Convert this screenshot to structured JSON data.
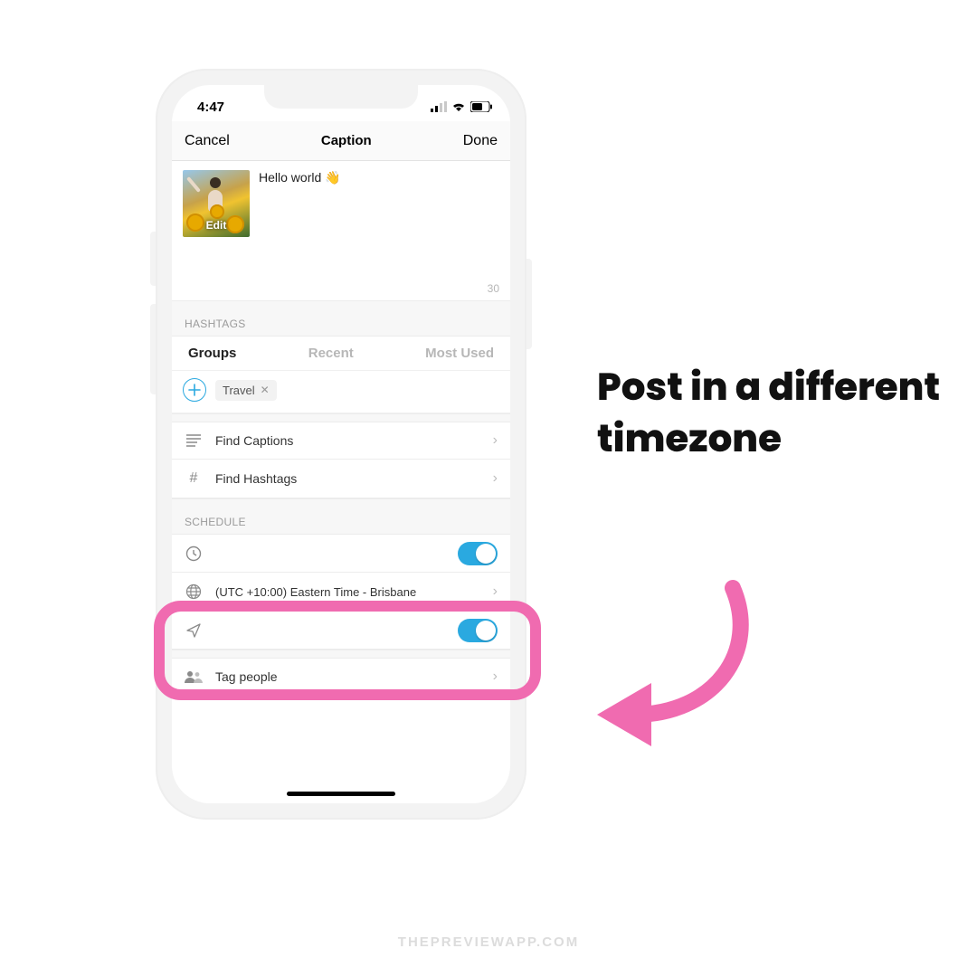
{
  "statusbar": {
    "time": "4:47"
  },
  "nav": {
    "cancel": "Cancel",
    "title": "Caption",
    "done": "Done"
  },
  "caption": {
    "text": "Hello world 👋",
    "edit": "Edit",
    "counter": "30"
  },
  "hashtags": {
    "header": "HASHTAGS",
    "tabs": {
      "groups": "Groups",
      "recent": "Recent",
      "most_used": "Most Used"
    },
    "chip": "Travel"
  },
  "rows": {
    "find_captions": "Find Captions",
    "find_hashtags": "Find Hashtags",
    "schedule_header": "SCHEDULE",
    "timezone": "(UTC +10:00) Eastern Time - Brisbane",
    "tag_people": "Tag people"
  },
  "callout": "Post in a different timezone",
  "watermark": "THEPREVIEWAPP.COM",
  "colors": {
    "accent": "#f06bb0",
    "toggle": "#2aa9e0"
  }
}
